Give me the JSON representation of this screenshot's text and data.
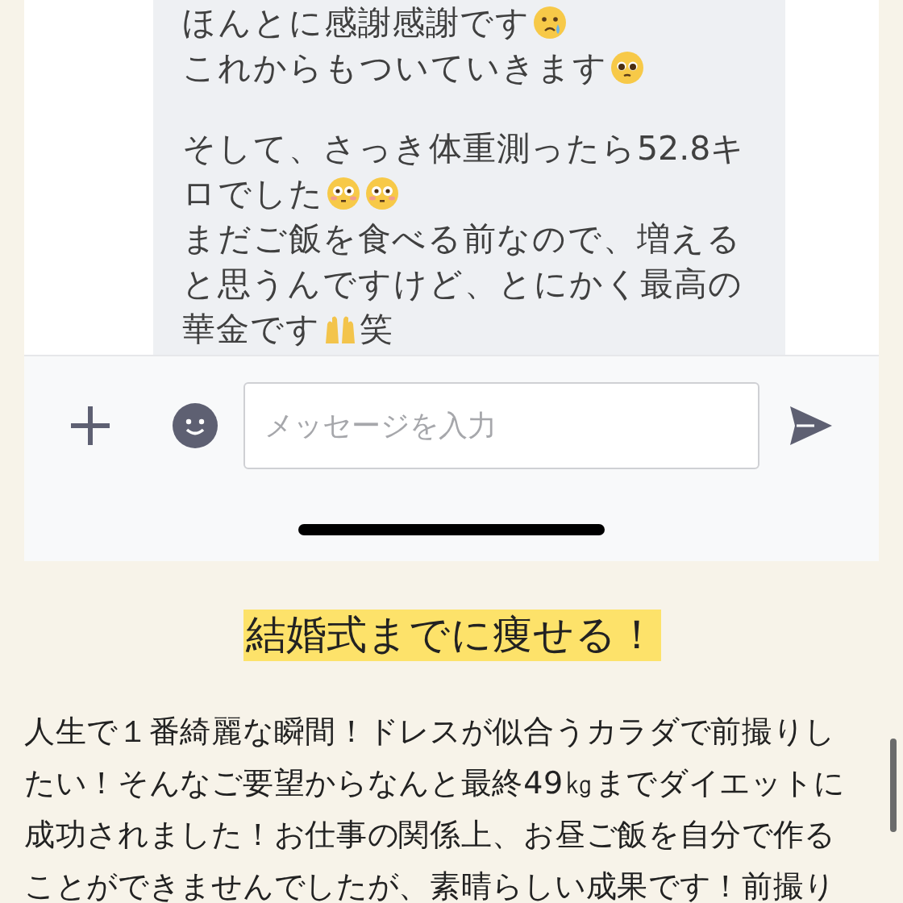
{
  "chat": {
    "paragraphs": [
      {
        "lines": [
          [
            {
              "kind": "text",
              "text": "ほんとに感謝感謝です"
            },
            {
              "kind": "crying-face"
            }
          ],
          [
            {
              "kind": "text",
              "text": "これからもついていきます"
            },
            {
              "kind": "pleading-face"
            }
          ]
        ]
      },
      {
        "lines": [
          [
            {
              "kind": "text",
              "text": "そして、さっき体重測ったら52.8キ"
            }
          ],
          [
            {
              "kind": "text",
              "text": "ロでした"
            },
            {
              "kind": "flushed-face"
            },
            {
              "kind": "flushed-face"
            }
          ],
          [
            {
              "kind": "text",
              "text": "まだご飯を食べる前なので、増える"
            }
          ],
          [
            {
              "kind": "text",
              "text": "と思うんですけど、とにかく最高の"
            }
          ],
          [
            {
              "kind": "text",
              "text": "華金です"
            },
            {
              "kind": "raised-hands"
            },
            {
              "kind": "text",
              "text": "笑"
            }
          ]
        ]
      }
    ],
    "input": {
      "placeholder": "メッセージを入力"
    }
  },
  "heading": "結婚式までに痩せる！",
  "paragraph": "人生で１番綺麗な瞬間！ドレスが似合うカラダで前撮りしたい！そんなご要望からなんと最終49㎏までダイエットに成功されました！お仕事の関係上、お昼ご飯を自分で作ることができませんでしたが、素晴らしい成果です！前撮り"
}
